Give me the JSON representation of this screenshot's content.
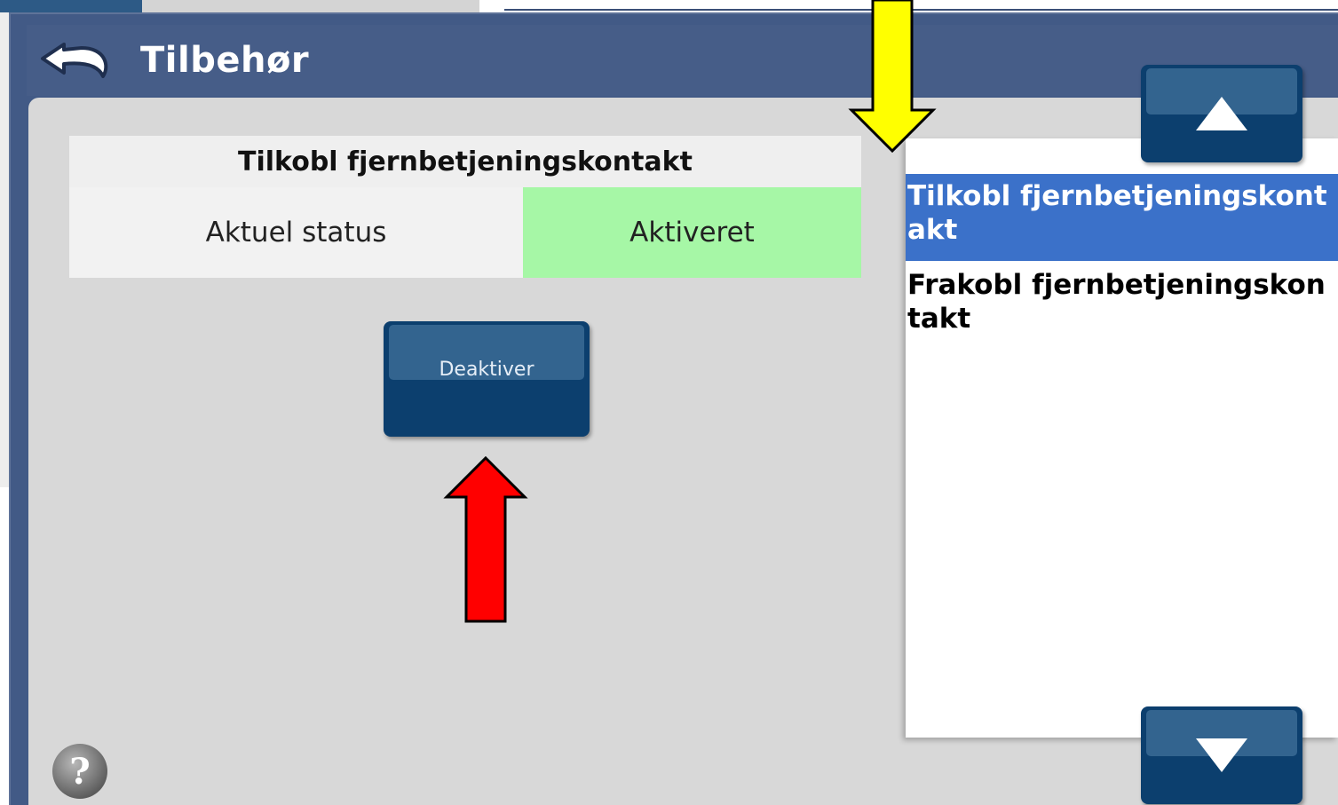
{
  "dialog": {
    "title": "Tilbehør"
  },
  "status_panel": {
    "heading": "Tilkobl fjernbetjeningskontakt",
    "label": "Aktuel status",
    "value": "Aktiveret",
    "value_color": "#a6f7a6"
  },
  "action_button": {
    "label": "Deaktiver"
  },
  "list": {
    "items": [
      {
        "label": "Tilkobl fjernbetjeningskontakt",
        "selected": true
      },
      {
        "label": "Frakobl fjernbetjeningskontakt",
        "selected": false
      }
    ],
    "selected_color": "#3b71c9"
  },
  "icons": {
    "back": "back-arrow-icon",
    "scroll_up": "triangle-up-icon",
    "scroll_down": "triangle-down-icon",
    "help": "question-mark-icon"
  },
  "annotations": {
    "yellow_arrow_color": "#ffff00",
    "red_arrow_color": "#ff0000"
  },
  "colors": {
    "header": "#465d88",
    "content": "#d8d8d8",
    "button": "#0c3f6e"
  }
}
